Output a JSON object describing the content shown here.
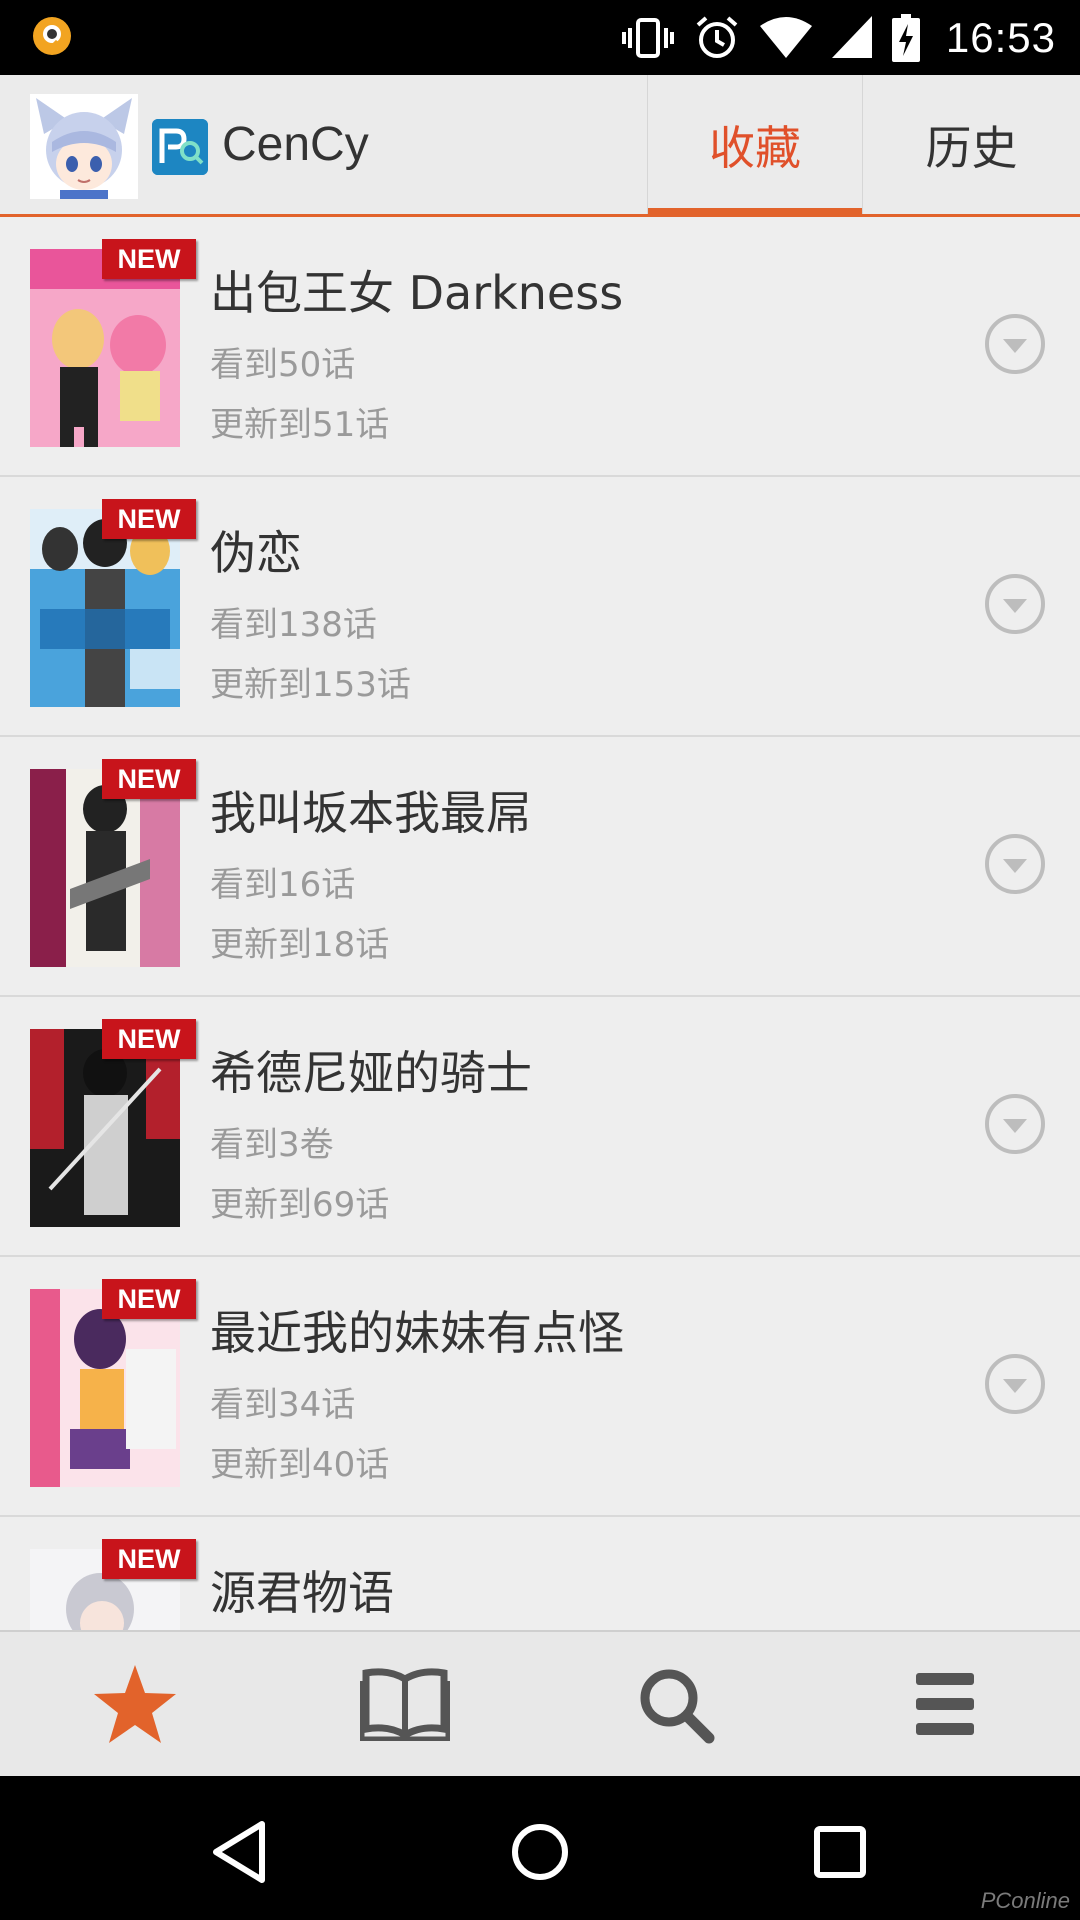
{
  "status_bar": {
    "time": "16:53",
    "icons": [
      "app-notification-icon",
      "vibrate-icon",
      "alarm-icon",
      "wifi-icon",
      "cell-signal-icon",
      "battery-charging-icon"
    ]
  },
  "header": {
    "app_title": "CenCy",
    "tabs": [
      {
        "label": "收藏",
        "active": true
      },
      {
        "label": "历史",
        "active": false
      }
    ]
  },
  "colors": {
    "accent": "#e2632b",
    "badge": "#c8141b",
    "header_bg": "#ebebeb",
    "list_bg": "#eeeeee"
  },
  "manga_list": [
    {
      "badge": "NEW",
      "title": "出包王女 Darkness",
      "read": "看到50话",
      "updated": "更新到51话"
    },
    {
      "badge": "NEW",
      "title": "伪恋",
      "read": "看到138话",
      "updated": "更新到153话"
    },
    {
      "badge": "NEW",
      "title": "我叫坂本我最屌",
      "read": "看到16话",
      "updated": "更新到18话"
    },
    {
      "badge": "NEW",
      "title": "希德尼娅的骑士",
      "read": "看到3卷",
      "updated": "更新到69话"
    },
    {
      "badge": "NEW",
      "title": "最近我的妹妹有点怪",
      "read": "看到34话",
      "updated": "更新到40话"
    },
    {
      "badge": "NEW",
      "title": "源君物语",
      "read": "",
      "updated": ""
    }
  ],
  "bottom_nav": [
    "star-icon",
    "book-icon",
    "search-icon",
    "menu-icon"
  ],
  "system_nav": [
    "back-icon",
    "home-icon",
    "recents-icon"
  ],
  "watermark": "PConline"
}
